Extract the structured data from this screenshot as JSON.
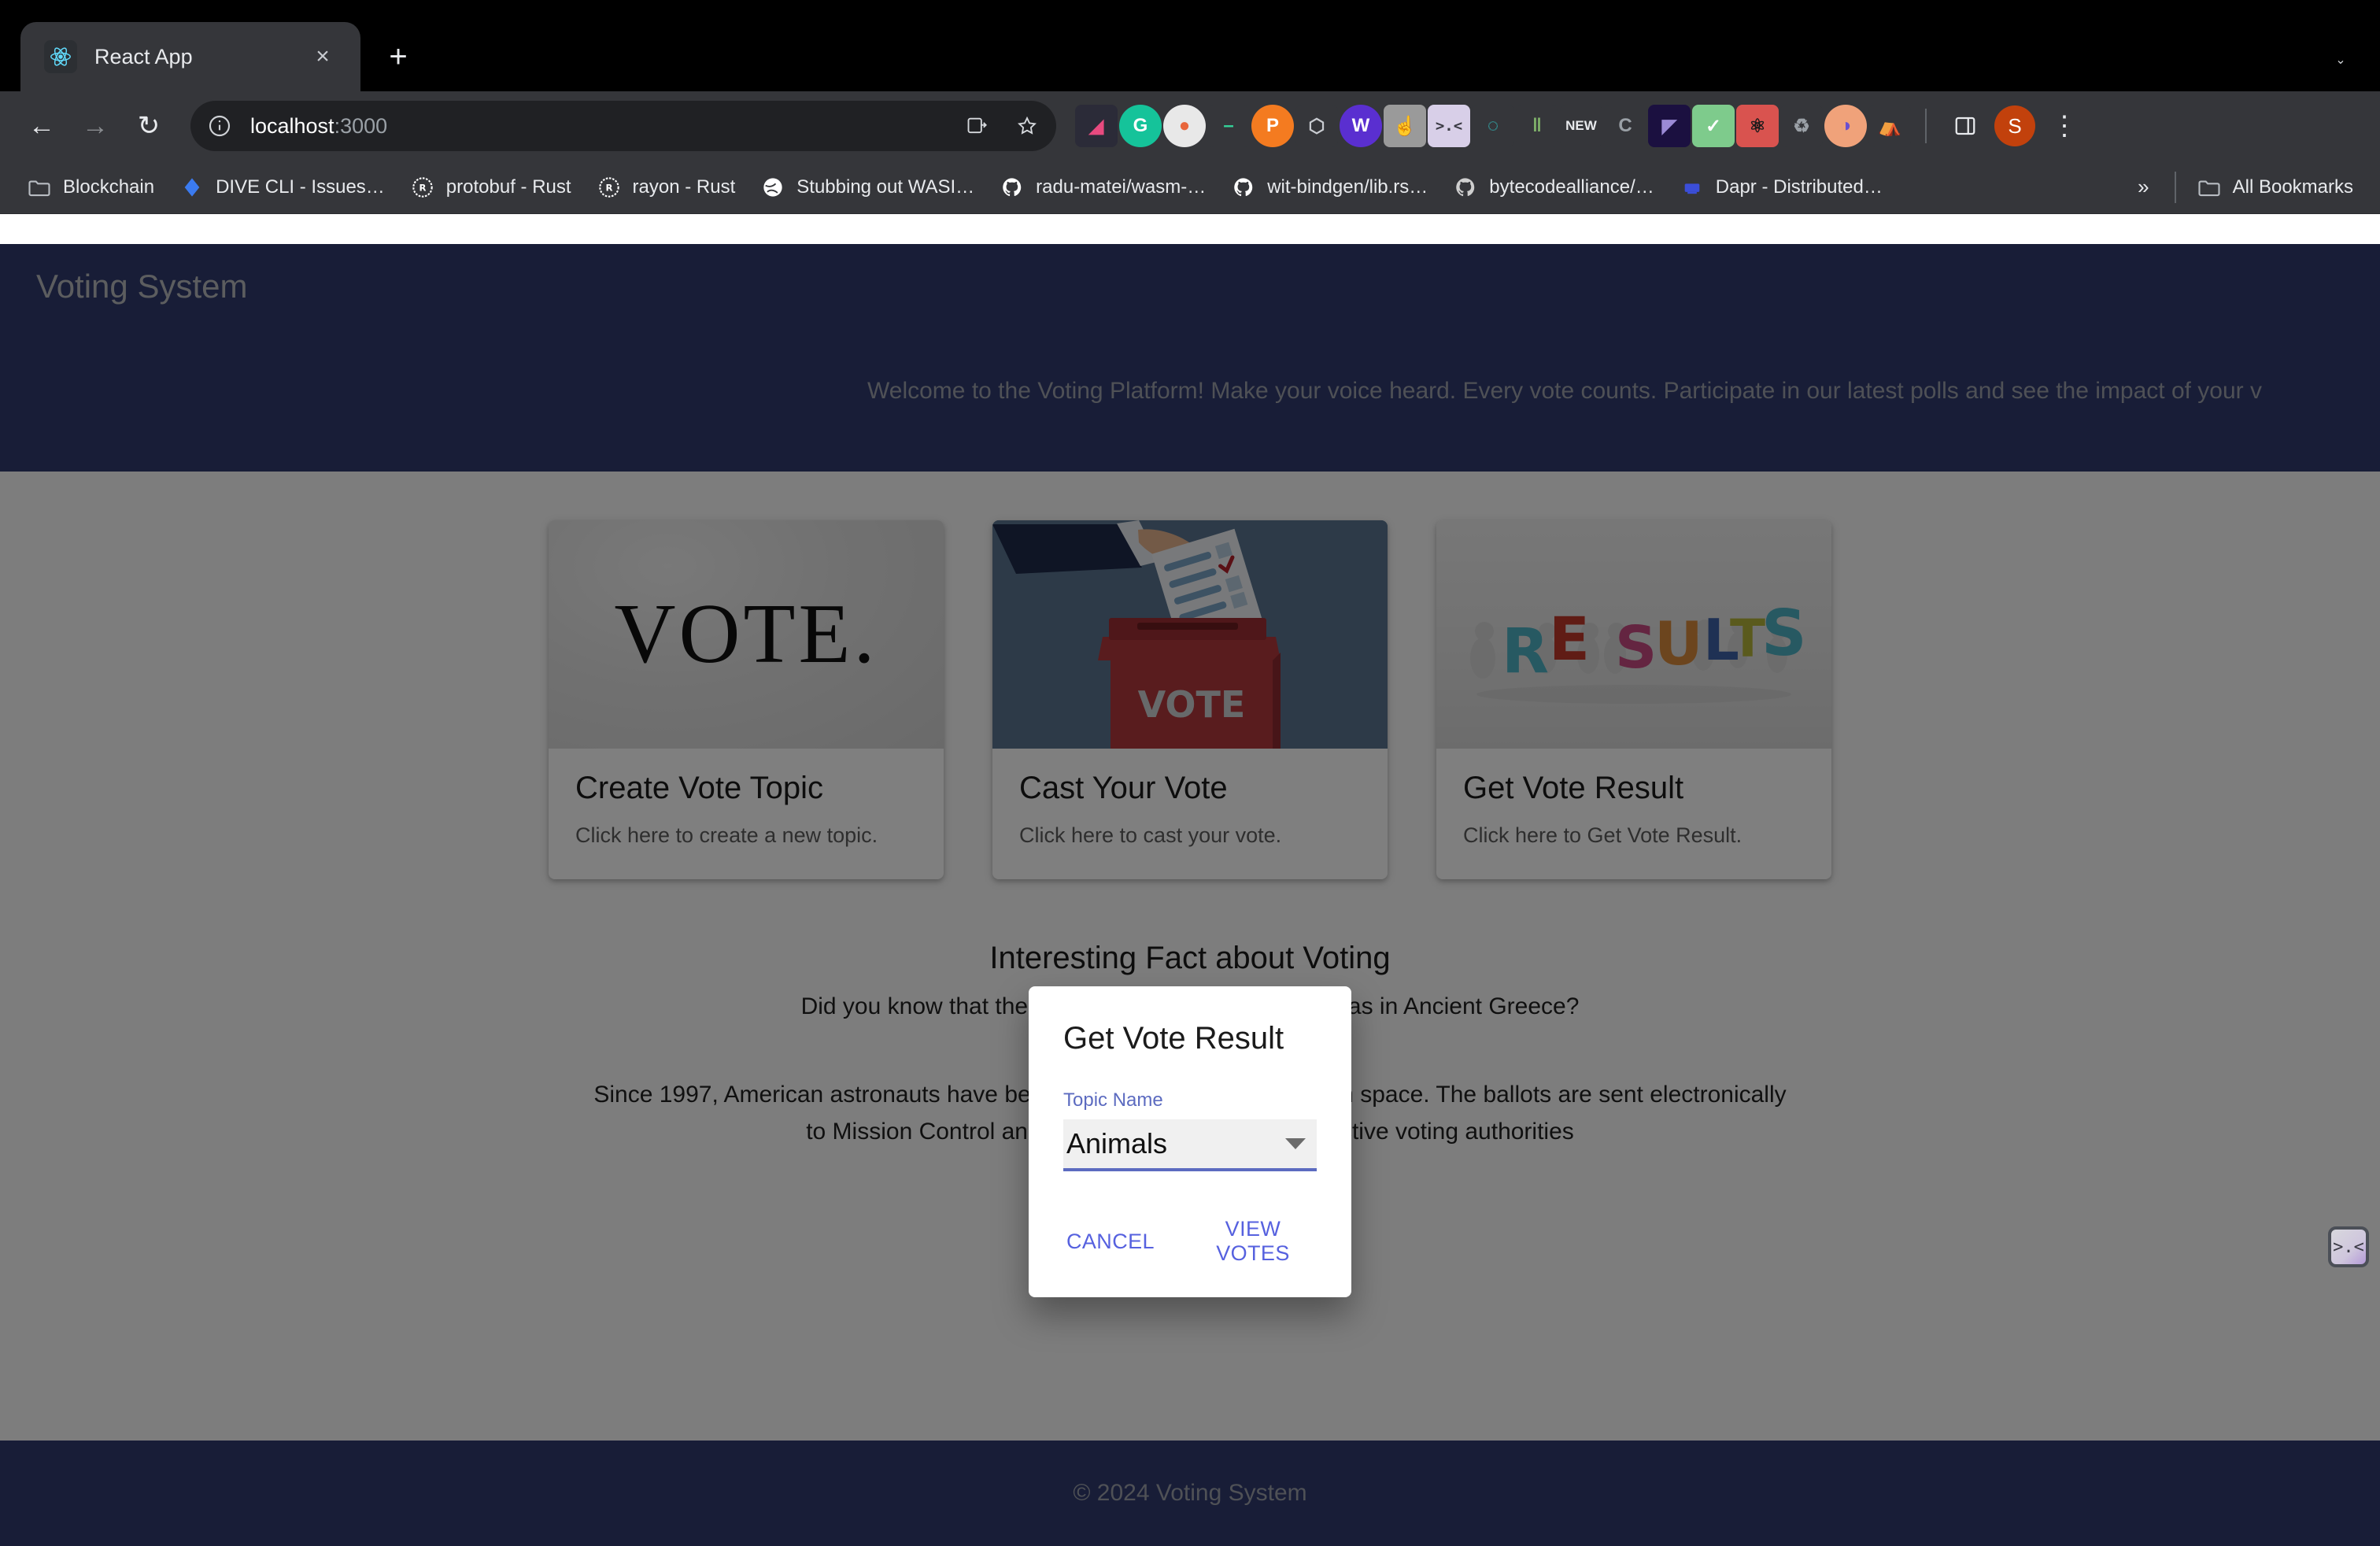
{
  "browser": {
    "tab": {
      "title": "React App",
      "favicon": "react-logo-icon",
      "close": "×"
    },
    "new_tab_label": "+",
    "tabstrip_collapse": "⌄",
    "nav": {
      "back": "←",
      "forward": "→",
      "reload": "↻"
    },
    "omnibox": {
      "info_icon": "site-info-icon",
      "url_host": "localhost",
      "url_port": ":3000",
      "install_icon": "install-app-icon",
      "bookmark_icon": "star-icon"
    },
    "profile_initial": "S",
    "menu_icon": "⋮",
    "extensions": [
      {
        "name": "framer-extension",
        "glyph": "◢",
        "bg": "#2b2b38",
        "fg": "#e84a7f"
      },
      {
        "name": "grammarly-extension",
        "glyph": "G",
        "bg": "#15c39a",
        "fg": "#ffffff"
      },
      {
        "name": "pocket-extension",
        "glyph": "●",
        "bg": "#e8e8e8",
        "fg": "#e8663c"
      },
      {
        "name": "dash-extension",
        "glyph": "–",
        "bg": "#35363a",
        "fg": "#34d399"
      },
      {
        "name": "polkadot-extension",
        "glyph": "P",
        "bg": "#f47b20",
        "fg": "#ffffff"
      },
      {
        "name": "box-extension",
        "glyph": "⬡",
        "bg": "#35363a",
        "fg": "#c9ccd1"
      },
      {
        "name": "wallet-extension",
        "glyph": "W",
        "bg": "#5a2fd0",
        "fg": "#ffffff"
      },
      {
        "name": "tap-extension",
        "glyph": "☝",
        "bg": "#9a9a9a",
        "fg": "#ffffff"
      },
      {
        "name": "face-extension",
        "glyph": ">.<",
        "bg": "#d8cfe8",
        "fg": "#3a3a44"
      },
      {
        "name": "ring-extension",
        "glyph": "◌",
        "bg": "#35363a",
        "fg": "#31c7c7"
      },
      {
        "name": "books-extension",
        "glyph": "‖",
        "bg": "#35363a",
        "fg": "#7fb069"
      },
      {
        "name": "new-badge-extension",
        "glyph": "NEW",
        "bg": "#35363a",
        "fg": "#e8eaed"
      },
      {
        "name": "c-extension",
        "glyph": "C",
        "bg": "#35363a",
        "fg": "#9aa0a6"
      },
      {
        "name": "a-extension",
        "glyph": "◤",
        "bg": "#1b1040",
        "fg": "#9b8ad6"
      },
      {
        "name": "shield-extension",
        "glyph": "✓",
        "bg": "#7ecb8c",
        "fg": "#ffffff"
      },
      {
        "name": "react-devtools-extension",
        "glyph": "⚛",
        "bg": "#d9534f",
        "fg": "#1b1b1b"
      },
      {
        "name": "recycle-extension",
        "glyph": "♻",
        "bg": "#35363a",
        "fg": "#9aa0a6"
      },
      {
        "name": "venn-extension",
        "glyph": "◑",
        "bg": "#f0a27a",
        "fg": "#6a4fd0"
      },
      {
        "name": "flask-extension",
        "glyph": "⛺",
        "bg": "#35363a",
        "fg": "#ffffff"
      }
    ],
    "side_panel_icon": "side-panel-icon",
    "bookmarks": [
      {
        "label": "Blockchain",
        "icon": "folder-icon",
        "color": "#b8bcc2"
      },
      {
        "label": "DIVE CLI - Issues…",
        "icon": "jira-icon",
        "color": "#3b7bf0"
      },
      {
        "label": "protobuf - Rust",
        "icon": "rust-icon",
        "color": "#ffffff"
      },
      {
        "label": "rayon - Rust",
        "icon": "rust-icon",
        "color": "#ffffff"
      },
      {
        "label": "Stubbing out WASI…",
        "icon": "globe-icon",
        "color": "#ffffff"
      },
      {
        "label": "radu-matei/wasm-…",
        "icon": "github-icon",
        "color": "#ffffff"
      },
      {
        "label": "wit-bindgen/lib.rs…",
        "icon": "github-icon",
        "color": "#ffffff"
      },
      {
        "label": "bytecodealliance/…",
        "icon": "github-icon",
        "color": "#cfcfcf"
      },
      {
        "label": "Dapr - Distributed…",
        "icon": "dapr-icon",
        "color": "#3b4ed8"
      }
    ],
    "bookmarks_overflow": "»",
    "all_bookmarks_label": "All Bookmarks",
    "all_bookmarks_icon": "folder-icon"
  },
  "page": {
    "header": {
      "title": "Voting System",
      "marquee": "Welcome to the Voting Platform! Make your voice heard. Every vote counts. Participate in our latest polls and see the impact of your v"
    },
    "cards": [
      {
        "image_alt": "VOTE.",
        "image_name": "vote-shirt-image",
        "title": "Create Vote Topic",
        "subtitle": "Click here to create a new topic."
      },
      {
        "image_alt": "VOTE",
        "image_name": "ballot-box-image",
        "title": "Cast Your Vote",
        "subtitle": "Click here to cast your vote."
      },
      {
        "image_alt": "RESULTS",
        "image_name": "results-letters-image",
        "title": "Get Vote Result",
        "subtitle": "Click here to Get Vote Result."
      }
    ],
    "fact": {
      "title": "Interesting Fact about Voting",
      "line": "Did you know that the first recorded vote in history was in Ancient Greece?",
      "paragraph": "Since 1997, American astronauts have been able to cast their votes from space. The ballots are sent electronically to Mission Control and then passed on to the respective voting authorities"
    },
    "footer": "© 2024 Voting System",
    "colors": {
      "header_bg": "#303a6e",
      "header_text": "#b9bbbe",
      "accent": "#5c6bc0",
      "link": "#5661df"
    }
  },
  "dialog": {
    "title": "Get Vote Result",
    "field_label": "Topic Name",
    "field_value": "Animals",
    "dropdown_icon": "chevron-down-icon",
    "cancel_label": "CANCEL",
    "submit_label": "VIEW VOTES"
  },
  "floating_widget": {
    "glyph": ">.<",
    "name": "face-widget"
  }
}
